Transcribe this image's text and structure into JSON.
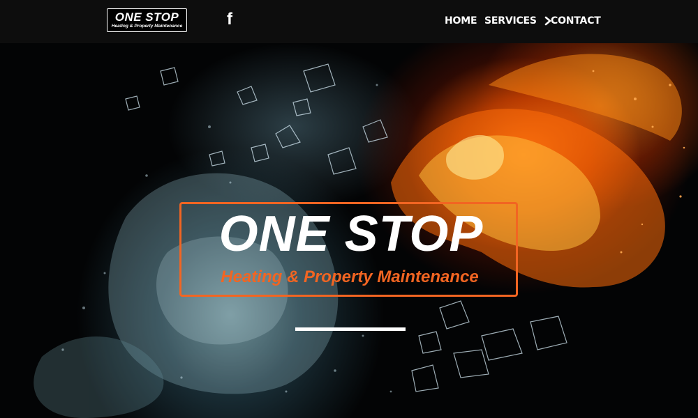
{
  "header": {
    "logo": {
      "title": "ONE STOP",
      "subtitle": "Heating & Property Maintenance"
    },
    "social": {
      "facebook_glyph": "f",
      "icon": "facebook-icon"
    },
    "nav": {
      "home": "HOME",
      "services": "SERVICES",
      "contact": "CONTACT",
      "services_icon": "chevron-right-icon"
    }
  },
  "hero": {
    "logo": {
      "title": "ONE STOP",
      "subtitle": "Heating & Property Maintenance"
    },
    "accent_color": "#f26522",
    "background": "fire-and-ice-fists"
  }
}
